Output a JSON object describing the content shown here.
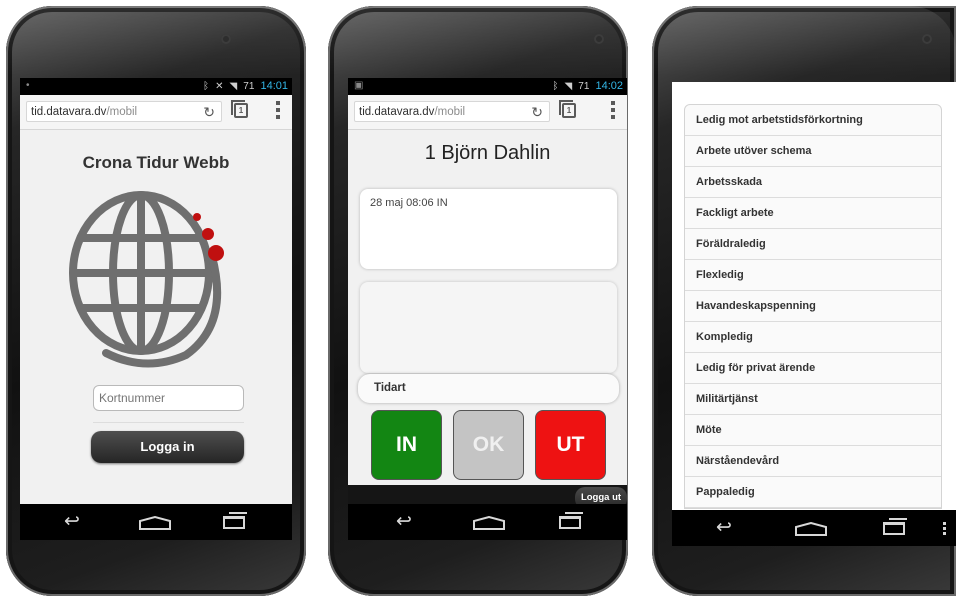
{
  "phone1": {
    "status": {
      "battery": "71",
      "time": "14:01"
    },
    "url": {
      "host": "tid.datavara.dv",
      "path": "/mobil"
    },
    "title": "Crona Tidur Webb",
    "card_placeholder": "Kortnummer",
    "login_label": "Logga in"
  },
  "phone2": {
    "status": {
      "battery": "71",
      "time": "14:02"
    },
    "url": {
      "host": "tid.datavara.dv",
      "path": "/mobil"
    },
    "title": "1 Björn Dahlin",
    "log_entry": "28 maj 08:06 IN",
    "tidart_label": "Tidart",
    "buttons": {
      "in": "IN",
      "ok": "OK",
      "ut": "UT"
    },
    "colors": {
      "in": "#138613",
      "ok": "#c4c4c4",
      "ut": "#ee1212"
    },
    "logout_label": "Logga ut"
  },
  "phone3": {
    "items": [
      "Ledig mot arbetstidsförkortning",
      "Arbete utöver schema",
      "Arbetsskada",
      "Fackligt arbete",
      "Föräldraledig",
      "Flexledig",
      "Havandeskapspenning",
      "Kompledig",
      "Ledig för privat ärende",
      "Militärtjänst",
      "Möte",
      "Närståendevård",
      "Pappaledig"
    ]
  },
  "icons": {
    "reload": "reload-icon",
    "tabs": "tabs-icon",
    "menu": "overflow-menu-icon",
    "back": "back-icon",
    "home": "home-icon",
    "recent": "recent-apps-icon"
  }
}
